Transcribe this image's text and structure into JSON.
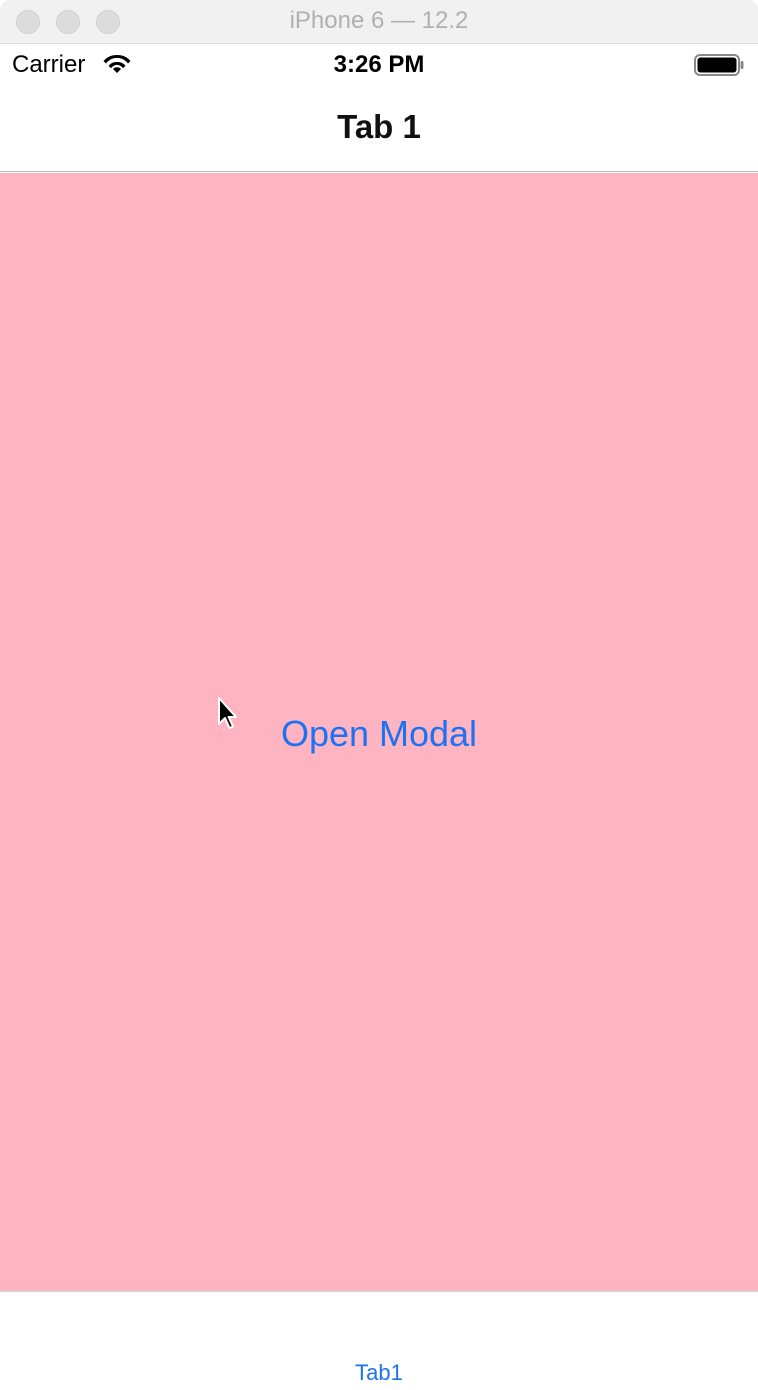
{
  "window": {
    "title": "iPhone 6 — 12.2"
  },
  "status_bar": {
    "carrier": "Carrier",
    "time": "3:26 PM"
  },
  "nav_bar": {
    "title": "Tab 1"
  },
  "content": {
    "background_color": "#feb5c1",
    "open_modal_label": "Open Modal"
  },
  "tab_bar": {
    "items": [
      {
        "label": "Tab1",
        "selected": true,
        "color": "#1d72f3"
      }
    ]
  }
}
